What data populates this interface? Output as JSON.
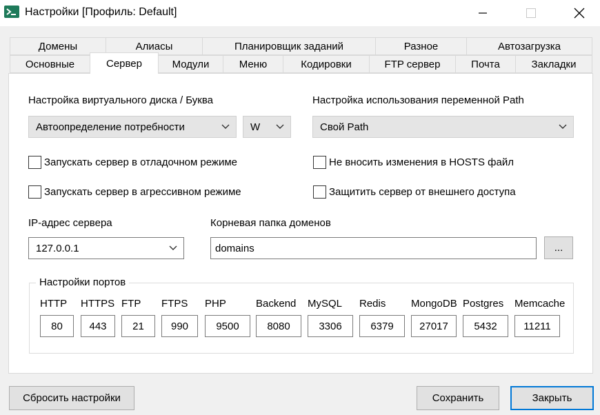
{
  "window": {
    "title": "Настройки [Профиль: Default]",
    "icon": "terminal-icon",
    "accent": "#0078d7"
  },
  "tabs_row_top": [
    {
      "label": "Домены"
    },
    {
      "label": "Алиасы"
    },
    {
      "label": "Планировщик заданий"
    },
    {
      "label": "Разное"
    },
    {
      "label": "Автозагрузка"
    }
  ],
  "tabs_row_bottom": [
    {
      "label": "Основные"
    },
    {
      "label": "Сервер",
      "active": true
    },
    {
      "label": "Модули"
    },
    {
      "label": "Меню"
    },
    {
      "label": "Кодировки"
    },
    {
      "label": "FTP сервер"
    },
    {
      "label": "Почта"
    },
    {
      "label": "Закладки"
    }
  ],
  "server": {
    "vdisk_label": "Настройка виртуального диска / Буква",
    "vdisk_select": "Автоопределение потребности",
    "drive_letter": "W",
    "path_label": "Настройка использования переменной Path",
    "path_select": "Свой Path",
    "cb_debug": "Запускать сервер в отладочном режиме",
    "cb_aggressive": "Запускать сервер в агрессивном режиме",
    "cb_hosts": "Не вносить изменения в HOSTS файл",
    "cb_protect": "Защитить сервер от внешнего доступа",
    "ip_label": "IP-адрес сервера",
    "ip_value": "127.0.0.1",
    "root_label": "Корневая папка доменов",
    "root_value": "domains",
    "browse_label": "..."
  },
  "ports": {
    "title": "Настройки портов",
    "items": [
      {
        "name": "HTTP",
        "value": "80"
      },
      {
        "name": "HTTPS",
        "value": "443"
      },
      {
        "name": "FTP",
        "value": "21"
      },
      {
        "name": "FTPS",
        "value": "990"
      },
      {
        "name": "PHP",
        "value": "9500"
      },
      {
        "name": "Backend",
        "value": "8080"
      },
      {
        "name": "MySQL",
        "value": "3306"
      },
      {
        "name": "Redis",
        "value": "6379"
      },
      {
        "name": "MongoDB",
        "value": "27017"
      },
      {
        "name": "Postgres",
        "value": "5432"
      },
      {
        "name": "Memcache",
        "value": "11211"
      }
    ]
  },
  "buttons": {
    "reset": "Сбросить настройки",
    "save": "Сохранить",
    "close": "Закрыть"
  }
}
